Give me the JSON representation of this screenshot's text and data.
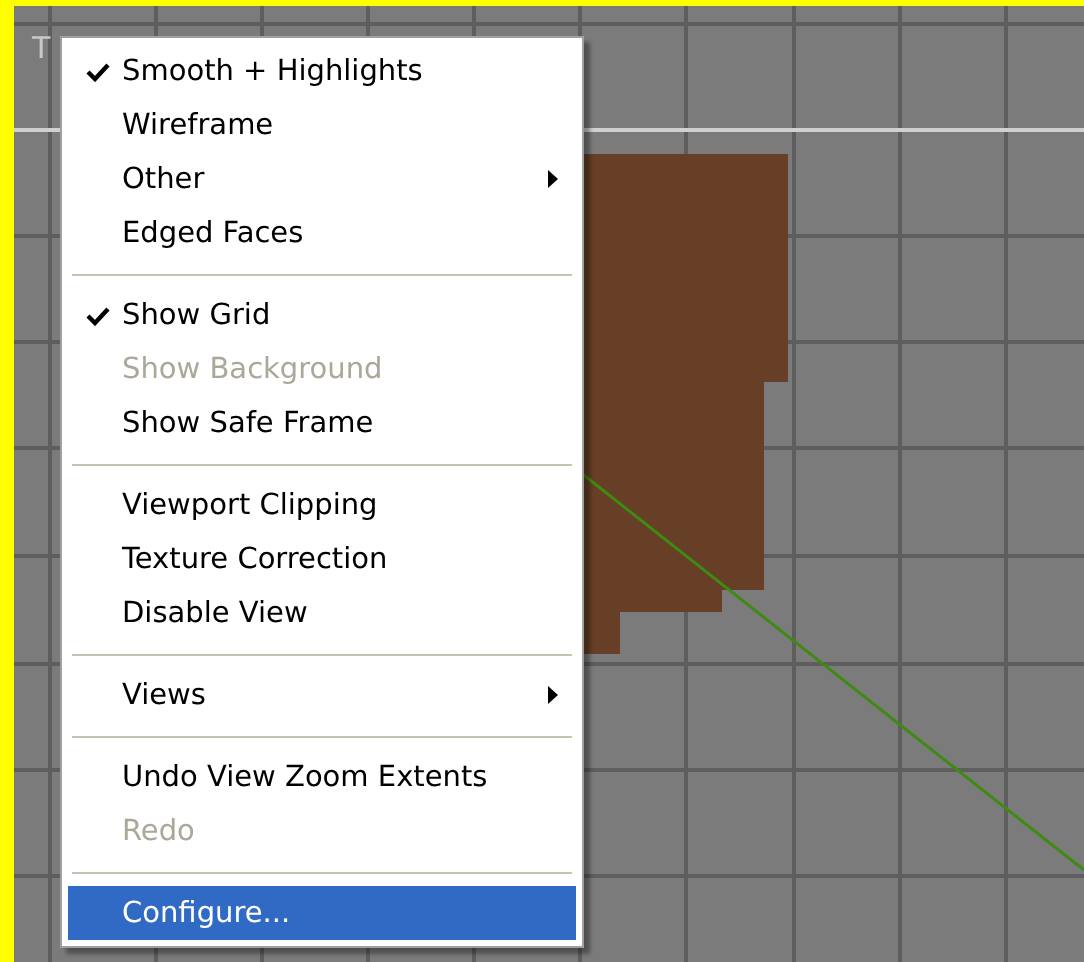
{
  "viewport": {
    "label": "T"
  },
  "context_menu": {
    "items": [
      {
        "kind": "item",
        "label": "Smooth + Highlights",
        "checked": true,
        "disabled": false,
        "submenu": false,
        "selected": false
      },
      {
        "kind": "item",
        "label": "Wireframe",
        "checked": false,
        "disabled": false,
        "submenu": false,
        "selected": false
      },
      {
        "kind": "item",
        "label": "Other",
        "checked": false,
        "disabled": false,
        "submenu": true,
        "selected": false
      },
      {
        "kind": "item",
        "label": "Edged Faces",
        "checked": false,
        "disabled": false,
        "submenu": false,
        "selected": false
      },
      {
        "kind": "separator"
      },
      {
        "kind": "item",
        "label": "Show Grid",
        "checked": true,
        "disabled": false,
        "submenu": false,
        "selected": false
      },
      {
        "kind": "item",
        "label": "Show Background",
        "checked": false,
        "disabled": true,
        "submenu": false,
        "selected": false
      },
      {
        "kind": "item",
        "label": "Show Safe Frame",
        "checked": false,
        "disabled": false,
        "submenu": false,
        "selected": false
      },
      {
        "kind": "separator"
      },
      {
        "kind": "item",
        "label": "Viewport Clipping",
        "checked": false,
        "disabled": false,
        "submenu": false,
        "selected": false
      },
      {
        "kind": "item",
        "label": "Texture Correction",
        "checked": false,
        "disabled": false,
        "submenu": false,
        "selected": false
      },
      {
        "kind": "item",
        "label": "Disable View",
        "checked": false,
        "disabled": false,
        "submenu": false,
        "selected": false
      },
      {
        "kind": "separator"
      },
      {
        "kind": "item",
        "label": "Views",
        "checked": false,
        "disabled": false,
        "submenu": true,
        "selected": false
      },
      {
        "kind": "separator"
      },
      {
        "kind": "item",
        "label": "Undo View Zoom Extents",
        "checked": false,
        "disabled": false,
        "submenu": false,
        "selected": false
      },
      {
        "kind": "item",
        "label": "Redo",
        "checked": false,
        "disabled": true,
        "submenu": false,
        "selected": false
      },
      {
        "kind": "separator"
      },
      {
        "kind": "item",
        "label": "Configure...",
        "checked": false,
        "disabled": false,
        "submenu": false,
        "selected": true
      }
    ]
  }
}
